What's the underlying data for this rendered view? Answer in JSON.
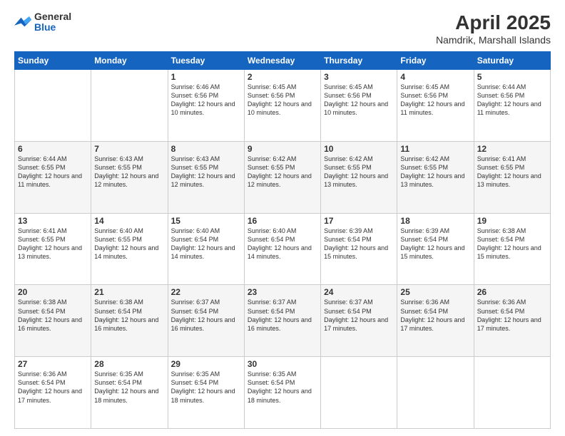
{
  "logo": {
    "general": "General",
    "blue": "Blue"
  },
  "title": "April 2025",
  "subtitle": "Namdrik, Marshall Islands",
  "days_header": [
    "Sunday",
    "Monday",
    "Tuesday",
    "Wednesday",
    "Thursday",
    "Friday",
    "Saturday"
  ],
  "weeks": [
    [
      {
        "day": "",
        "sunrise": "",
        "sunset": "",
        "daylight": ""
      },
      {
        "day": "",
        "sunrise": "",
        "sunset": "",
        "daylight": ""
      },
      {
        "day": "1",
        "sunrise": "Sunrise: 6:46 AM",
        "sunset": "Sunset: 6:56 PM",
        "daylight": "Daylight: 12 hours and 10 minutes."
      },
      {
        "day": "2",
        "sunrise": "Sunrise: 6:45 AM",
        "sunset": "Sunset: 6:56 PM",
        "daylight": "Daylight: 12 hours and 10 minutes."
      },
      {
        "day": "3",
        "sunrise": "Sunrise: 6:45 AM",
        "sunset": "Sunset: 6:56 PM",
        "daylight": "Daylight: 12 hours and 10 minutes."
      },
      {
        "day": "4",
        "sunrise": "Sunrise: 6:45 AM",
        "sunset": "Sunset: 6:56 PM",
        "daylight": "Daylight: 12 hours and 11 minutes."
      },
      {
        "day": "5",
        "sunrise": "Sunrise: 6:44 AM",
        "sunset": "Sunset: 6:56 PM",
        "daylight": "Daylight: 12 hours and 11 minutes."
      }
    ],
    [
      {
        "day": "6",
        "sunrise": "Sunrise: 6:44 AM",
        "sunset": "Sunset: 6:55 PM",
        "daylight": "Daylight: 12 hours and 11 minutes."
      },
      {
        "day": "7",
        "sunrise": "Sunrise: 6:43 AM",
        "sunset": "Sunset: 6:55 PM",
        "daylight": "Daylight: 12 hours and 12 minutes."
      },
      {
        "day": "8",
        "sunrise": "Sunrise: 6:43 AM",
        "sunset": "Sunset: 6:55 PM",
        "daylight": "Daylight: 12 hours and 12 minutes."
      },
      {
        "day": "9",
        "sunrise": "Sunrise: 6:42 AM",
        "sunset": "Sunset: 6:55 PM",
        "daylight": "Daylight: 12 hours and 12 minutes."
      },
      {
        "day": "10",
        "sunrise": "Sunrise: 6:42 AM",
        "sunset": "Sunset: 6:55 PM",
        "daylight": "Daylight: 12 hours and 13 minutes."
      },
      {
        "day": "11",
        "sunrise": "Sunrise: 6:42 AM",
        "sunset": "Sunset: 6:55 PM",
        "daylight": "Daylight: 12 hours and 13 minutes."
      },
      {
        "day": "12",
        "sunrise": "Sunrise: 6:41 AM",
        "sunset": "Sunset: 6:55 PM",
        "daylight": "Daylight: 12 hours and 13 minutes."
      }
    ],
    [
      {
        "day": "13",
        "sunrise": "Sunrise: 6:41 AM",
        "sunset": "Sunset: 6:55 PM",
        "daylight": "Daylight: 12 hours and 13 minutes."
      },
      {
        "day": "14",
        "sunrise": "Sunrise: 6:40 AM",
        "sunset": "Sunset: 6:55 PM",
        "daylight": "Daylight: 12 hours and 14 minutes."
      },
      {
        "day": "15",
        "sunrise": "Sunrise: 6:40 AM",
        "sunset": "Sunset: 6:54 PM",
        "daylight": "Daylight: 12 hours and 14 minutes."
      },
      {
        "day": "16",
        "sunrise": "Sunrise: 6:40 AM",
        "sunset": "Sunset: 6:54 PM",
        "daylight": "Daylight: 12 hours and 14 minutes."
      },
      {
        "day": "17",
        "sunrise": "Sunrise: 6:39 AM",
        "sunset": "Sunset: 6:54 PM",
        "daylight": "Daylight: 12 hours and 15 minutes."
      },
      {
        "day": "18",
        "sunrise": "Sunrise: 6:39 AM",
        "sunset": "Sunset: 6:54 PM",
        "daylight": "Daylight: 12 hours and 15 minutes."
      },
      {
        "day": "19",
        "sunrise": "Sunrise: 6:38 AM",
        "sunset": "Sunset: 6:54 PM",
        "daylight": "Daylight: 12 hours and 15 minutes."
      }
    ],
    [
      {
        "day": "20",
        "sunrise": "Sunrise: 6:38 AM",
        "sunset": "Sunset: 6:54 PM",
        "daylight": "Daylight: 12 hours and 16 minutes."
      },
      {
        "day": "21",
        "sunrise": "Sunrise: 6:38 AM",
        "sunset": "Sunset: 6:54 PM",
        "daylight": "Daylight: 12 hours and 16 minutes."
      },
      {
        "day": "22",
        "sunrise": "Sunrise: 6:37 AM",
        "sunset": "Sunset: 6:54 PM",
        "daylight": "Daylight: 12 hours and 16 minutes."
      },
      {
        "day": "23",
        "sunrise": "Sunrise: 6:37 AM",
        "sunset": "Sunset: 6:54 PM",
        "daylight": "Daylight: 12 hours and 16 minutes."
      },
      {
        "day": "24",
        "sunrise": "Sunrise: 6:37 AM",
        "sunset": "Sunset: 6:54 PM",
        "daylight": "Daylight: 12 hours and 17 minutes."
      },
      {
        "day": "25",
        "sunrise": "Sunrise: 6:36 AM",
        "sunset": "Sunset: 6:54 PM",
        "daylight": "Daylight: 12 hours and 17 minutes."
      },
      {
        "day": "26",
        "sunrise": "Sunrise: 6:36 AM",
        "sunset": "Sunset: 6:54 PM",
        "daylight": "Daylight: 12 hours and 17 minutes."
      }
    ],
    [
      {
        "day": "27",
        "sunrise": "Sunrise: 6:36 AM",
        "sunset": "Sunset: 6:54 PM",
        "daylight": "Daylight: 12 hours and 17 minutes."
      },
      {
        "day": "28",
        "sunrise": "Sunrise: 6:35 AM",
        "sunset": "Sunset: 6:54 PM",
        "daylight": "Daylight: 12 hours and 18 minutes."
      },
      {
        "day": "29",
        "sunrise": "Sunrise: 6:35 AM",
        "sunset": "Sunset: 6:54 PM",
        "daylight": "Daylight: 12 hours and 18 minutes."
      },
      {
        "day": "30",
        "sunrise": "Sunrise: 6:35 AM",
        "sunset": "Sunset: 6:54 PM",
        "daylight": "Daylight: 12 hours and 18 minutes."
      },
      {
        "day": "",
        "sunrise": "",
        "sunset": "",
        "daylight": ""
      },
      {
        "day": "",
        "sunrise": "",
        "sunset": "",
        "daylight": ""
      },
      {
        "day": "",
        "sunrise": "",
        "sunset": "",
        "daylight": ""
      }
    ]
  ]
}
